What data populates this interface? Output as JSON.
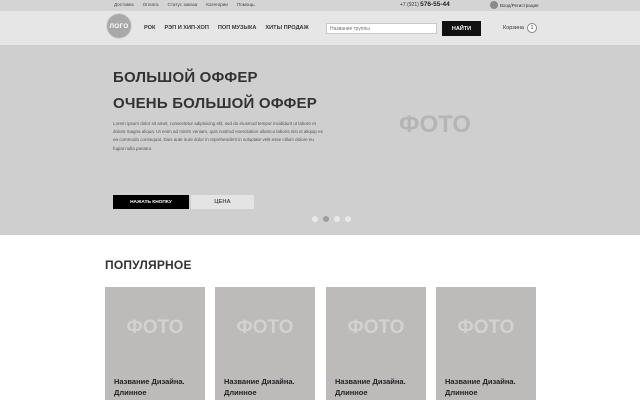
{
  "topbar": {
    "links": [
      "Доставка",
      "Оплата",
      "Статус заказа",
      "Категории",
      "Помощь"
    ],
    "phone_prefix": "+7 (921)",
    "phone_number": "576-55-44",
    "login_label": "Вход/Регистрация"
  },
  "header": {
    "logo_text": "ЛОГО",
    "nav": [
      "РОК",
      "РЭП И ХИП-ХОП",
      "ПОП МУЗЫКА",
      "ХИТЫ ПРОДАЖ"
    ],
    "search_placeholder": "Название группы",
    "search_button": "НАЙТИ",
    "cart_label": "Корзина",
    "cart_count": "1"
  },
  "hero": {
    "title_line1": "БОЛЬШОЙ ОФФЕР",
    "title_line2": "ОЧЕНЬ БОЛЬШОЙ ОФФЕР",
    "body": "Lorem ipsum dolor sit amet, consectetur adipisicing elit, sed do eiusmod tempor incididunt ut labore et dolore magna aliqua. Ut enim ad minim veniam, quis nostrud exercitation ullamco laboris nisi ut aliquip ex ea commodo consequat. Duis aute irure dolor in reprehenderit in voluptate velit esse cillum dolore eu fugiat nulla pariatur.",
    "cta_button": "НАЖАТЬ КНОПКУ",
    "price_button": "ЦЕНА",
    "photo_text": "ФОТО",
    "slider": {
      "count": 4,
      "active_index": 1
    }
  },
  "popular": {
    "title": "ПОПУЛЯРНОЕ",
    "cards": [
      {
        "photo": "ФОТО",
        "name": "Название Дизайна. Длинное"
      },
      {
        "photo": "ФОТО",
        "name": "Название Дизайна. Длинное"
      },
      {
        "photo": "ФОТО",
        "name": "Название Дизайна. Длинное"
      },
      {
        "photo": "ФОТО",
        "name": "Название Дизайна. Длинное"
      }
    ]
  }
}
